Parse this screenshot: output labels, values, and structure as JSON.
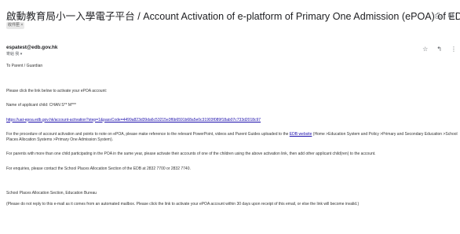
{
  "subject": "啟動教育局小一入學電子平台 / Account Activation of e-platform of Primary One Admission (ePOA) of EDB",
  "label": "收件匣 ×",
  "sender": "espatest@edb.gov.hk",
  "recipient": "寄給 我 ▾",
  "header_icons": [
    "print-icon",
    "new-window-icon"
  ],
  "action_icons": [
    "star-icon",
    "reply-icon",
    "more-icon"
  ],
  "body": {
    "greeting": "To Parent / Guardian",
    "p1": "Please click the link below to activate your ePOA account:",
    "p2": "Name of applicant child: CHAN S** M***",
    "activation_link": "https://uat-epoa.edb.gov.hk/account-activation?step=1&passCode=4499a823d39da6c53215e3f6b6591b68a5e0c31903f089f18ab07c733d2018c97",
    "p3_before": "For the procedure of account activation and points to note on ePOA, please make reference to the relevant PowerPoint, videos and Parent Guides uploaded to the ",
    "p3_link": "EDB website",
    "p3_after": " (Home >Education System and Policy >Primary and Secondary Education >School Places Allocation Systems >Primary One Admission System).",
    "p4": "For parents with more than one child participating in the POA in the same year, please activate their accounts of one of the children using the above activation link, then add other applicant child(ren) to the account.",
    "p5": "For enquiries, please contact the School Places Allocation Section of the EDB at 2832 7700 or 2832 7740.",
    "signature": "School Places Allocation Section, Education Bureau",
    "footer_note": "(Please do not reply to this e-mail as it comes from an automated mailbox. Please click the link to activate your ePOA account within 30 days upon receipt of this email, or else the link will become invalid.)"
  }
}
